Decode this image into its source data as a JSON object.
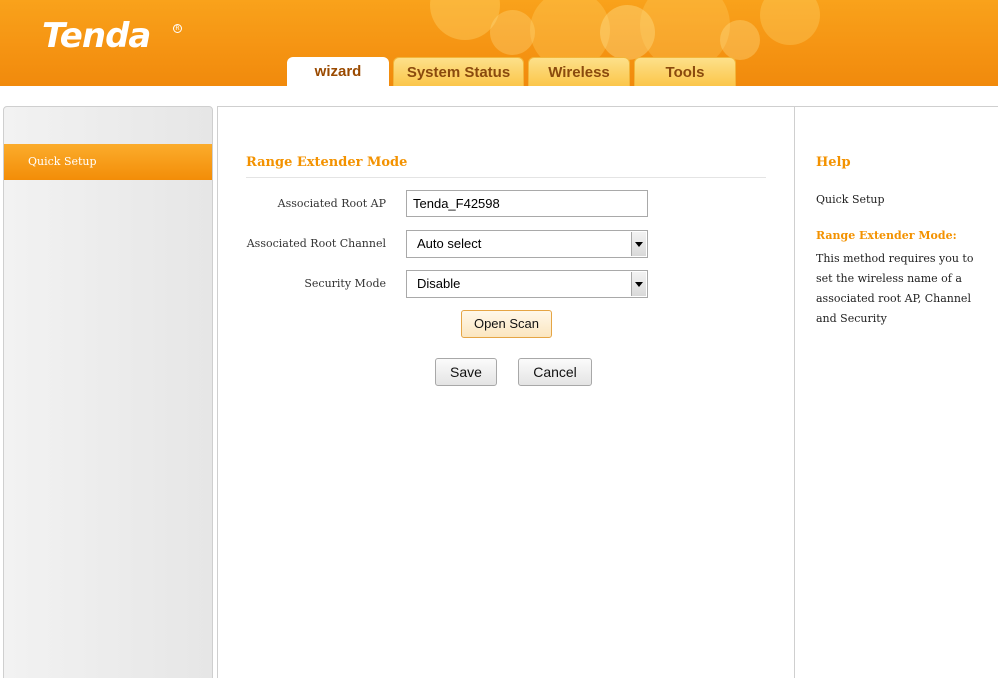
{
  "header": {
    "logo_text": "Tenda",
    "logo_mark": "R",
    "tabs": [
      {
        "label": "wizard",
        "active": true
      },
      {
        "label": "System Status",
        "active": false
      },
      {
        "label": "Wireless",
        "active": false
      },
      {
        "label": "Tools",
        "active": false
      }
    ]
  },
  "sidebar": {
    "items": [
      {
        "label": "Quick Setup",
        "active": true
      }
    ]
  },
  "main": {
    "section_title": "Range Extender Mode",
    "fields": {
      "root_ap": {
        "label": "Associated Root AP",
        "value": "Tenda_F42598"
      },
      "root_channel": {
        "label": "Associated Root Channel",
        "value": "Auto select"
      },
      "security_mode": {
        "label": "Security Mode",
        "value": "Disable"
      }
    },
    "buttons": {
      "open_scan": "Open Scan",
      "save": "Save",
      "cancel": "Cancel"
    }
  },
  "help": {
    "title": "Help",
    "subtitle": "Quick Setup",
    "heading": "Range Extender Mode:",
    "text": "This method requires you to set the wireless name of a associated root AP, Channel and Security"
  },
  "colors": {
    "brand_orange": "#f39200",
    "header_bg": "#f59312",
    "tab_active_text": "#9a4a00",
    "tab_inactive_bg": "#fbc64a"
  },
  "icons": {
    "select_arrow": "chevron-down-icon"
  }
}
